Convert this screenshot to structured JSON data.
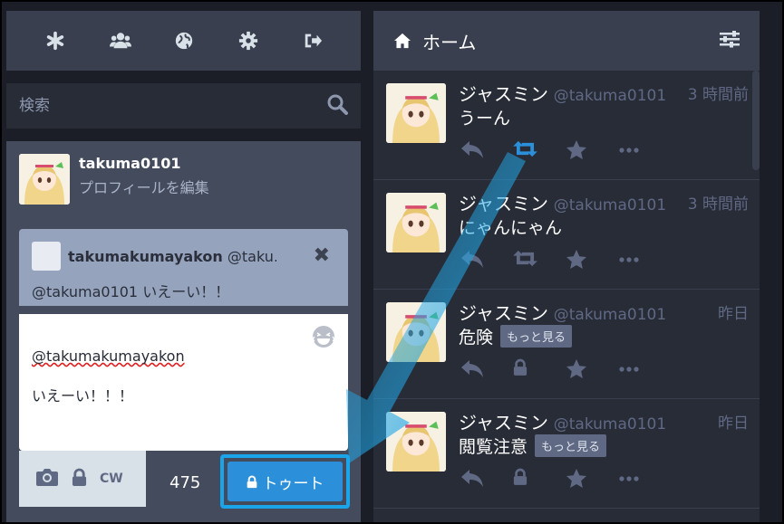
{
  "nav": {
    "icons": [
      "asterisk-icon",
      "users-icon",
      "globe-icon",
      "gear-icon",
      "sign-out-icon"
    ]
  },
  "search": {
    "placeholder": "検索"
  },
  "profile": {
    "username": "takuma0101",
    "edit_label": "プロフィールを編集"
  },
  "reply_to": {
    "display_name": "takumakumayakon",
    "acct_truncated": "@taku…",
    "text": "@takuma0101 いえーい！！"
  },
  "compose": {
    "mention": "@takumakumayakon",
    "body": "いえーい！！！",
    "cw_label": "CW",
    "char_count": "475",
    "toot_label": "トゥート"
  },
  "column": {
    "title": "ホーム"
  },
  "toots": [
    {
      "name": "ジャスミン",
      "acct": "@takuma0101",
      "time": "3 時間前",
      "content": "うーん",
      "more": "",
      "boosted": true,
      "locked": false
    },
    {
      "name": "ジャスミン",
      "acct": "@takuma0101",
      "time": "3 時間前",
      "content": "にゃんにゃん",
      "more": "",
      "boosted": false,
      "locked": false
    },
    {
      "name": "ジャスミン",
      "acct": "@takuma0101",
      "time": "昨日",
      "content": "危険",
      "more": "もっと見る",
      "boosted": false,
      "locked": true
    },
    {
      "name": "ジャスミン",
      "acct": "@takuma0101",
      "time": "昨日",
      "content": "閲覧注意",
      "more": "もっと見る",
      "boosted": false,
      "locked": true
    }
  ],
  "colors": {
    "accent": "#2b90d9",
    "boost_active": "#2b90d9",
    "highlight_border": "#1aa4ea"
  }
}
